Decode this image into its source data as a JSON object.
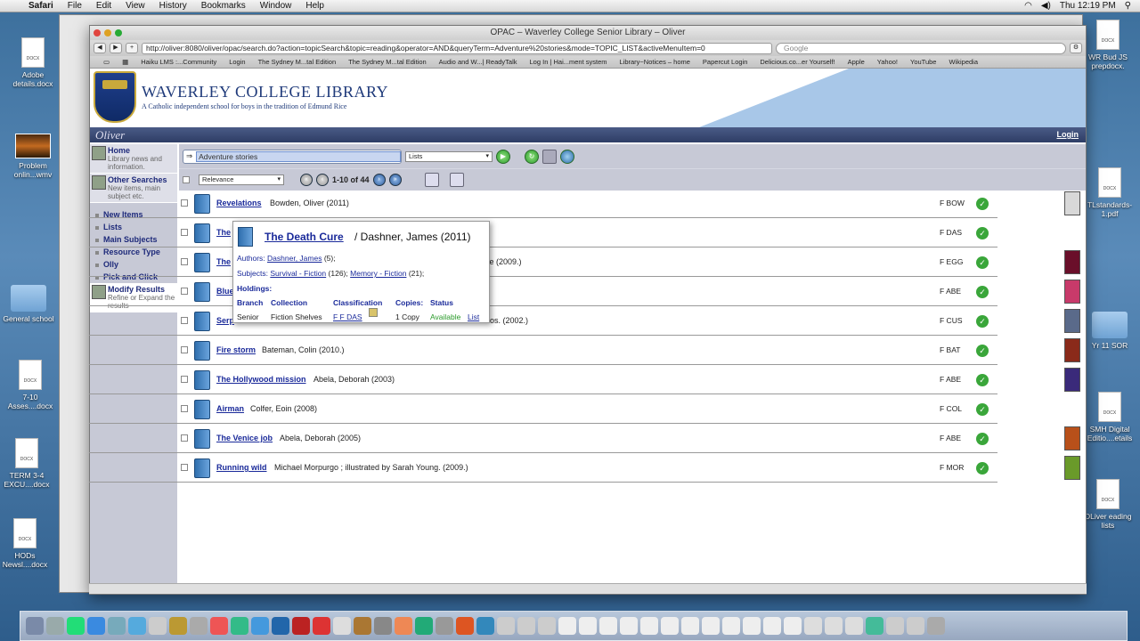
{
  "menubar": {
    "app": "Safari",
    "items": [
      "File",
      "Edit",
      "View",
      "History",
      "Bookmarks",
      "Window",
      "Help"
    ],
    "clock": "Thu 12:19 PM"
  },
  "desktop": {
    "left_icons": [
      {
        "label": "Adobe details.docx",
        "kind": "doc"
      },
      {
        "label": "Problem onlin...wmv",
        "kind": "pic"
      },
      {
        "label": "General school",
        "kind": "folder"
      },
      {
        "label": "7-10 Asses....docx",
        "kind": "doc"
      },
      {
        "label": "TERM 3-4 EXCU....docx",
        "kind": "doc"
      },
      {
        "label": "HODs Newsl....docx",
        "kind": "doc"
      }
    ],
    "right_icons": [
      {
        "label": "WR Bud JS prepdocx.",
        "kind": "doc"
      },
      {
        "label": "TLstandards-1.pdf",
        "kind": "doc"
      },
      {
        "label": "Yr 11 SOR",
        "kind": "folder"
      },
      {
        "label": "SMH Digital Editio....etails",
        "kind": "doc"
      },
      {
        "label": "OLiver eading lists",
        "kind": "doc"
      }
    ]
  },
  "browser": {
    "title": "OPAC – Waverley College Senior Library – Oliver",
    "url": "http://oliver:8080/oliver/opac/search.do?action=topicSearch&topic=reading&operator=AND&queryTerm=Adventure%20stories&mode=TOPIC_LIST&activeMenuItem=0",
    "search_placeholder": "Google",
    "bookmarks": [
      "Haiku LMS :...Community",
      "Login",
      "The Sydney M...tal Edition",
      "The Sydney M...tal Edition",
      "Audio and W...| ReadyTalk",
      "Log In | Hai...ment system",
      "Library~Notices – home",
      "Papercut Login",
      "Delicious.co...er Yourself!",
      "Apple",
      "Yahoo!",
      "YouTube",
      "Wikipedia"
    ]
  },
  "site": {
    "title": "WAVERLEY COLLEGE LIBRARY",
    "subtitle": "A Catholic independent school for boys in the tradition of Edmund Rice",
    "app_name": "Oliver",
    "login": "Login"
  },
  "sidebar": {
    "home": {
      "label": "Home",
      "desc": "Library news and information."
    },
    "other": {
      "label": "Other Searches",
      "desc": "New items, main subject etc."
    },
    "links": [
      "New Items",
      "Lists",
      "Main Subjects",
      "Resource Type",
      "Olly",
      "Pick and Click"
    ],
    "modify": {
      "label": "Modify Results",
      "desc": "Refine or Expand the results"
    }
  },
  "search": {
    "query": "Adventure stories",
    "list_select": "Lists",
    "sort_select": "Relevance",
    "count": "1-10 of 44"
  },
  "results": [
    {
      "title": "Revelations",
      "meta": "Bowden, Oliver  (2011)",
      "call": "F BOW",
      "cover": "#d8d8d8"
    },
    {
      "title": "The",
      "meta": "",
      "call": "F DAS",
      "cover": ""
    },
    {
      "title": "The",
      "meta": "ve  (2009.)",
      "call": "F EGG",
      "cover": "#6a0f2a"
    },
    {
      "title": "Blue",
      "meta": "",
      "call": "F ABE",
      "cover": "#c83a6a"
    },
    {
      "title": "Serp",
      "meta": "os.  (2002.)",
      "call": "F CUS",
      "cover": "#5a6a8a"
    },
    {
      "title": "Fire storm",
      "meta": "Bateman, Colin  (2010.)",
      "call": "F BAT",
      "cover": "#8a2a1a"
    },
    {
      "title": "The Hollywood mission",
      "meta": "Abela, Deborah  (2003)",
      "call": "F ABE",
      "cover": "#3a2a7a"
    },
    {
      "title": "Airman",
      "meta": "Colfer, Eoin  (2008)",
      "call": "F COL",
      "cover": ""
    },
    {
      "title": "The Venice job",
      "meta": "Abela, Deborah  (2005)",
      "call": "F ABE",
      "cover": "#b8501a"
    },
    {
      "title": "Running wild",
      "meta": "Michael Morpurgo ; illustrated by Sarah Young.  (2009.)",
      "call": "F MOR",
      "cover": "#6a9a2a"
    }
  ],
  "popup": {
    "title": "The Death Cure",
    "author": "/  Dashner, James  (2011)",
    "authors_label": "Authors:",
    "author_link": "Dashner, James",
    "author_count": "(5);",
    "subjects_label": "Subjects:",
    "subject1": "Survival - Fiction",
    "subject1_count": "(126);",
    "subject2": "Memory - Fiction",
    "subject2_count": "(21);",
    "holdings_label": "Holdings:",
    "headers": {
      "branch": "Branch",
      "collection": "Collection",
      "classification": "Classification",
      "copies": "Copies:",
      "status": "Status"
    },
    "row": {
      "branch": "Senior",
      "collection": "Fiction Shelves",
      "classification": "F F DAS",
      "copies": "1 Copy",
      "status": "Available",
      "list": "List"
    }
  }
}
